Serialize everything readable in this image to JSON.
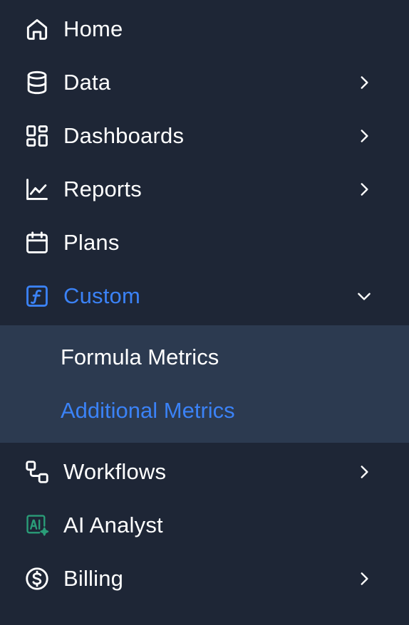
{
  "nav": {
    "home": {
      "label": "Home",
      "icon": "home-icon"
    },
    "data": {
      "label": "Data",
      "icon": "database-icon"
    },
    "dashboards": {
      "label": "Dashboards",
      "icon": "dashboard-grid-icon"
    },
    "reports": {
      "label": "Reports",
      "icon": "line-chart-icon"
    },
    "plans": {
      "label": "Plans",
      "icon": "calendar-icon"
    },
    "custom": {
      "label": "Custom",
      "icon": "function-icon",
      "expanded": true
    },
    "custom_submenu": [
      {
        "label": "Formula Metrics",
        "active": false
      },
      {
        "label": "Additional Metrics",
        "active": true
      }
    ],
    "workflows": {
      "label": "Workflows",
      "icon": "workflow-icon"
    },
    "ai_analyst": {
      "label": "AI Analyst",
      "icon": "ai-analyst-icon"
    },
    "billing": {
      "label": "Billing",
      "icon": "dollar-circle-icon"
    }
  },
  "colors": {
    "background": "#1e2636",
    "submenu_background": "#2c3a50",
    "text": "#ffffff",
    "accent": "#3b82f6",
    "ai_icon": "#2a9d78"
  }
}
